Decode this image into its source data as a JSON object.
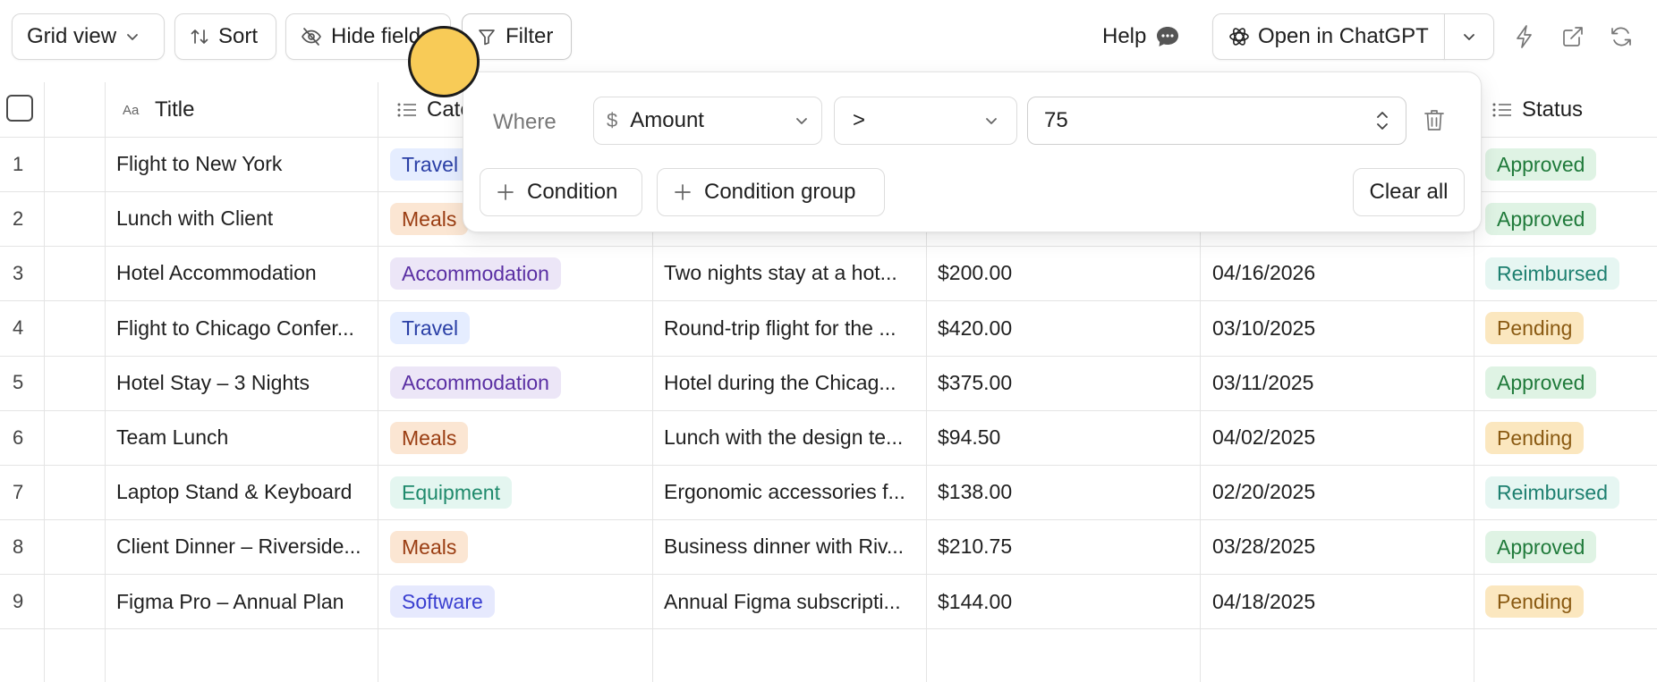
{
  "toolbar": {
    "grid_view": "Grid view",
    "sort": "Sort",
    "hide_fields": "Hide fields",
    "filter": "Filter",
    "help": "Help",
    "open_chatgpt": "Open in ChatGPT"
  },
  "columns": {
    "title": "Title",
    "category": "Category",
    "status": "Status"
  },
  "filter": {
    "where": "Where",
    "field": "Amount",
    "operator": ">",
    "value": "75",
    "add_condition": "Condition",
    "add_condition_group": "Condition group",
    "clear_all": "Clear all"
  },
  "rows": [
    {
      "n": "1",
      "title": "Flight to New York",
      "category": "Travel",
      "description": "",
      "amount": "",
      "date": "",
      "status": "Approved"
    },
    {
      "n": "2",
      "title": "Lunch with Client",
      "category": "Meals",
      "description": "",
      "amount": "",
      "date": "",
      "status": "Approved"
    },
    {
      "n": "3",
      "title": "Hotel Accommodation",
      "category": "Accommodation",
      "description": "Two nights stay at a hot...",
      "amount": "$200.00",
      "date": "04/16/2026",
      "status": "Reimbursed"
    },
    {
      "n": "4",
      "title": "Flight to Chicago Confer...",
      "category": "Travel",
      "description": "Round-trip flight for the ...",
      "amount": "$420.00",
      "date": "03/10/2025",
      "status": "Pending"
    },
    {
      "n": "5",
      "title": "Hotel Stay – 3 Nights",
      "category": "Accommodation",
      "description": "Hotel during the Chicag...",
      "amount": "$375.00",
      "date": "03/11/2025",
      "status": "Approved"
    },
    {
      "n": "6",
      "title": "Team Lunch",
      "category": "Meals",
      "description": "Lunch with the design te...",
      "amount": "$94.50",
      "date": "04/02/2025",
      "status": "Pending"
    },
    {
      "n": "7",
      "title": "Laptop Stand & Keyboard",
      "category": "Equipment",
      "description": "Ergonomic accessories f...",
      "amount": "$138.00",
      "date": "02/20/2025",
      "status": "Reimbursed"
    },
    {
      "n": "8",
      "title": "Client Dinner – Riverside...",
      "category": "Meals",
      "description": "Business dinner with Riv...",
      "amount": "$210.75",
      "date": "03/28/2025",
      "status": "Approved"
    },
    {
      "n": "9",
      "title": "Figma Pro – Annual Plan",
      "category": "Software",
      "description": "Annual Figma subscripti...",
      "amount": "$144.00",
      "date": "04/18/2025",
      "status": "Pending"
    }
  ],
  "tag_colors": {
    "Travel": {
      "bg": "#e5edff",
      "fg": "#2a3fa6"
    },
    "Meals": {
      "bg": "#fbe6d3",
      "fg": "#9a3d12"
    },
    "Accommodation": {
      "bg": "#ece6f7",
      "fg": "#5a2fa3"
    },
    "Equipment": {
      "bg": "#e4f6f0",
      "fg": "#1f8a6c"
    },
    "Software": {
      "bg": "#e6e9fd",
      "fg": "#3a3fd0"
    },
    "Approved": {
      "bg": "#dff3e4",
      "fg": "#1f7a3a"
    },
    "Pending": {
      "bg": "#fbe7bf",
      "fg": "#8a5a12"
    },
    "Reimbursed": {
      "bg": "#e6f6f2",
      "fg": "#1e8070"
    }
  }
}
